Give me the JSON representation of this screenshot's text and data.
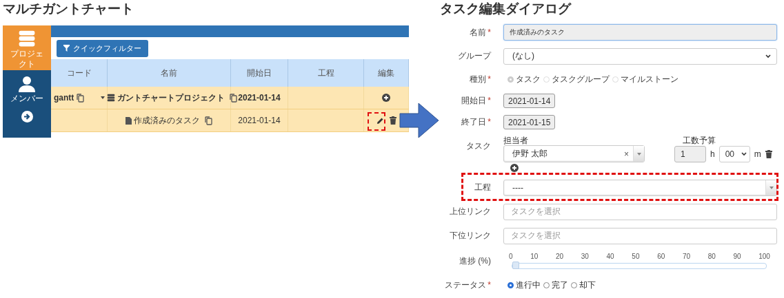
{
  "gantt": {
    "title": "マルチガントチャート",
    "sidebar": [
      {
        "label": "プロジェクト",
        "selected": true
      },
      {
        "label": "メンバー",
        "selected": false
      }
    ],
    "filter_button": "クイックフィルター",
    "columns": [
      "コード",
      "名前",
      "開始日",
      "工程",
      "編集"
    ],
    "rows": [
      {
        "kind": "project",
        "code": "gantt",
        "name": "ガントチャートプロジェクト",
        "start": "2021-01-14",
        "expanded": true,
        "highlighted": false
      },
      {
        "kind": "task",
        "name": "作成済みのタスク",
        "start": "2021-01-14",
        "highlighted": true
      }
    ]
  },
  "dialog": {
    "title": "タスク編集ダイアログ",
    "fields": [
      {
        "kind": "text",
        "label": "名前",
        "required": "*",
        "value": "作成済みのタスク",
        "focused": true
      },
      {
        "kind": "select",
        "label": "グループ",
        "value": "(なし)"
      },
      {
        "kind": "radio",
        "label": "種別",
        "required": "*",
        "disabled": true,
        "options": [
          {
            "label": "タスク",
            "selected": true
          },
          {
            "label": "タスクグループ",
            "selected": false
          },
          {
            "label": "マイルストーン",
            "selected": false
          }
        ]
      },
      {
        "kind": "date",
        "label": "開始日",
        "required": "*",
        "value": "2021-01-14"
      },
      {
        "kind": "date",
        "label": "終了日",
        "required": "*",
        "value": "2021-01-15"
      },
      {
        "kind": "assignee",
        "label": "タスク",
        "assignee_label": "担当者",
        "assignee": "伊野 太郎",
        "clear": "×",
        "budget_label": "工数予算",
        "hours": "1",
        "hours_unit": "h",
        "minutes": "00",
        "minutes_unit": "m"
      },
      {
        "kind": "combo",
        "label": "工程",
        "value": "----",
        "highlighted": true
      },
      {
        "kind": "search",
        "label": "上位リンク",
        "placeholder": "タスクを選択"
      },
      {
        "kind": "search",
        "label": "下位リンク",
        "placeholder": "タスクを選択"
      },
      {
        "kind": "slider",
        "label": "進捗 (%)",
        "ticks": [
          "0",
          "10",
          "20",
          "30",
          "40",
          "50",
          "60",
          "70",
          "80",
          "90",
          "100"
        ],
        "level": 0
      },
      {
        "kind": "radio",
        "label": "ステータス",
        "required": "*",
        "disabled": false,
        "options": [
          {
            "label": "進行中",
            "selected": true
          },
          {
            "label": "完了",
            "selected": false
          },
          {
            "label": "却下",
            "selected": false
          }
        ]
      }
    ]
  }
}
